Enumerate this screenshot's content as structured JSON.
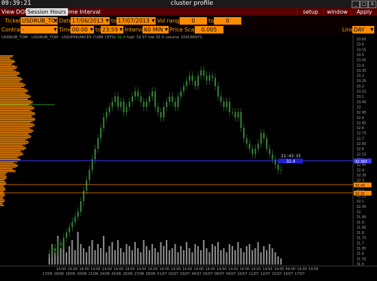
{
  "titlebar": {
    "clock": "09:39:21",
    "title": "cluster profile",
    "buttons": [
      "_",
      "□",
      "X"
    ]
  },
  "menubar": {
    "items": [
      "View DOM",
      "Session Hours",
      "Time Interval"
    ],
    "active_index": 1,
    "right_buttons": [
      "setup",
      "window",
      "Apply"
    ]
  },
  "controls": {
    "ticker_label": "Ticker",
    "ticker_value": "USDRUB_TOI",
    "date_label": "Date",
    "date_from": "17/06/2013",
    "to_label": "to",
    "date_to": "17/07/2013",
    "vol_range_label": "Vol range",
    "vol_from": "0",
    "vol_to_label": "to",
    "vol_to": "0",
    "contract_label": "Contract",
    "contract_value": "-",
    "time_label": "Time",
    "time_from": "00:00",
    "time_to_label": "to",
    "time_to": "23:59",
    "interval_label": "Interval",
    "interval_value": "60 MIN",
    "price_scale_label": "Price Scale",
    "price_scale_value": "0.005",
    "line_label": "Line",
    "line_value": "DAY"
  },
  "info": {
    "symbol": "USDRUB_TOM - USDRUB_TOM - USD/РУБ(MICEX CURR CETS)",
    "last": "32.4",
    "high_label": "high",
    "high": "33.37",
    "low_label": "low",
    "low": "31.5",
    "volume_label": "volume",
    "volume": "109186971"
  },
  "crosshair": {
    "time": "21:43:15",
    "price": "32.4",
    "price_axis": "32.393"
  },
  "markers": {
    "level1": "32.43",
    "level2": "32.31"
  },
  "colors": {
    "background": "#000000",
    "menubar": "#5a0000",
    "field": "#ff8c00",
    "label": "#ffa500",
    "candle": "#2e6b2e",
    "profile": "#ff8c00",
    "current_line": "#3a3aff",
    "level_line": "#ff8c00",
    "volume": "#bbbbbb"
  },
  "y_axis": [
    "33.65",
    "33.6",
    "33.55",
    "33.5",
    "33.45",
    "33.4",
    "33.35",
    "33.3",
    "33.25",
    "33.2",
    "33.15",
    "33.1",
    "33.05",
    "33",
    "32.95",
    "32.9",
    "32.85",
    "32.8",
    "32.75",
    "32.7",
    "32.65",
    "32.6",
    "32.55",
    "32.5",
    "32.45",
    "32.4",
    "32.35",
    "32.3",
    "32.25",
    "32.2",
    "32.15",
    "32.1",
    "32.05",
    "32",
    "31.95",
    "31.9",
    "31.85",
    "31.8",
    "31.75",
    "31.7",
    "31.65",
    "31.6",
    "31.55",
    "31.5"
  ],
  "x_axis": [
    {
      "t": "14:00",
      "d": "17/06"
    },
    {
      "t": "14:00",
      "d": "18/06"
    },
    {
      "t": "14:00",
      "d": "19/06"
    },
    {
      "t": "14:00",
      "d": "20/06"
    },
    {
      "t": "14:00",
      "d": "21/06"
    },
    {
      "t": "14:00",
      "d": "24/06"
    },
    {
      "t": "14:00",
      "d": "25/06"
    },
    {
      "t": "14:00",
      "d": "26/06"
    },
    {
      "t": "14:00",
      "d": "27/06"
    },
    {
      "t": "14:00",
      "d": "28/06"
    },
    {
      "t": "14:00",
      "d": "01/07"
    },
    {
      "t": "14:00",
      "d": "02/07"
    },
    {
      "t": "14:00",
      "d": "03/07"
    },
    {
      "t": "14:00",
      "d": "04/07"
    },
    {
      "t": "14:00",
      "d": "05/07"
    },
    {
      "t": "14:00",
      "d": "08/07"
    },
    {
      "t": "14:00",
      "d": "09/07"
    },
    {
      "t": "14:00",
      "d": "10/07"
    },
    {
      "t": "14:00",
      "d": "11/07"
    },
    {
      "t": "14:00",
      "d": "12/07"
    },
    {
      "t": "09:00",
      "d": "15/07"
    },
    {
      "t": "14:00",
      "d": "16/07"
    },
    {
      "t": "14:00",
      "d": "17/07"
    }
  ],
  "chart_data": {
    "type": "candlestick-cluster",
    "closes": [
      31.6,
      31.65,
      31.62,
      31.7,
      31.68,
      31.75,
      31.8,
      31.85,
      31.9,
      31.95,
      32.0,
      32.1,
      32.2,
      32.3,
      32.4,
      32.5,
      32.6,
      32.7,
      32.8,
      32.9,
      32.95,
      33.0,
      33.05,
      33.1,
      33.0,
      33.05,
      32.95,
      33.0,
      33.05,
      33.1,
      33.15,
      33.1,
      33.05,
      33.0,
      33.05,
      33.1,
      33.15,
      33.0,
      32.95,
      32.9,
      33.0,
      33.05,
      33.1,
      33.05,
      33.0,
      33.1,
      33.15,
      33.2,
      33.25,
      33.3,
      33.25,
      33.2,
      33.3,
      33.35,
      33.3,
      33.25,
      33.3,
      33.28,
      33.2,
      33.1,
      33.05,
      33.0,
      33.05,
      32.95,
      32.95,
      32.9,
      32.95,
      32.8,
      32.7,
      32.65,
      32.6,
      32.55,
      32.6,
      32.65,
      32.75,
      32.7,
      32.6,
      32.55,
      32.5,
      32.45,
      32.4,
      32.4
    ],
    "volumes": [
      0.25,
      0.5,
      0.3,
      0.7,
      0.4,
      0.55,
      0.3,
      0.45,
      0.6,
      0.35,
      0.8,
      0.5,
      0.4,
      0.3,
      0.45,
      0.6,
      0.35,
      0.5,
      0.4,
      0.7,
      0.3,
      0.45,
      0.55,
      0.35,
      0.6,
      0.4,
      0.3,
      0.5,
      0.45,
      0.35,
      0.55,
      0.4,
      0.3,
      0.6,
      0.45,
      0.35,
      0.5,
      0.4,
      0.3,
      0.55,
      0.45,
      0.6,
      0.35,
      0.4,
      0.5,
      0.3,
      0.45,
      0.35,
      0.55,
      0.4,
      0.3,
      0.5,
      0.45,
      0.35,
      0.6,
      0.4,
      0.3,
      0.5,
      0.45,
      0.55,
      0.35,
      0.4,
      0.3,
      0.5,
      0.45,
      0.35,
      0.55,
      0.4,
      0.3,
      0.45,
      0.5,
      0.35,
      0.4,
      0.55,
      0.3,
      0.45,
      0.35,
      0.5,
      0.4,
      0.3,
      0.2,
      0.15
    ]
  }
}
